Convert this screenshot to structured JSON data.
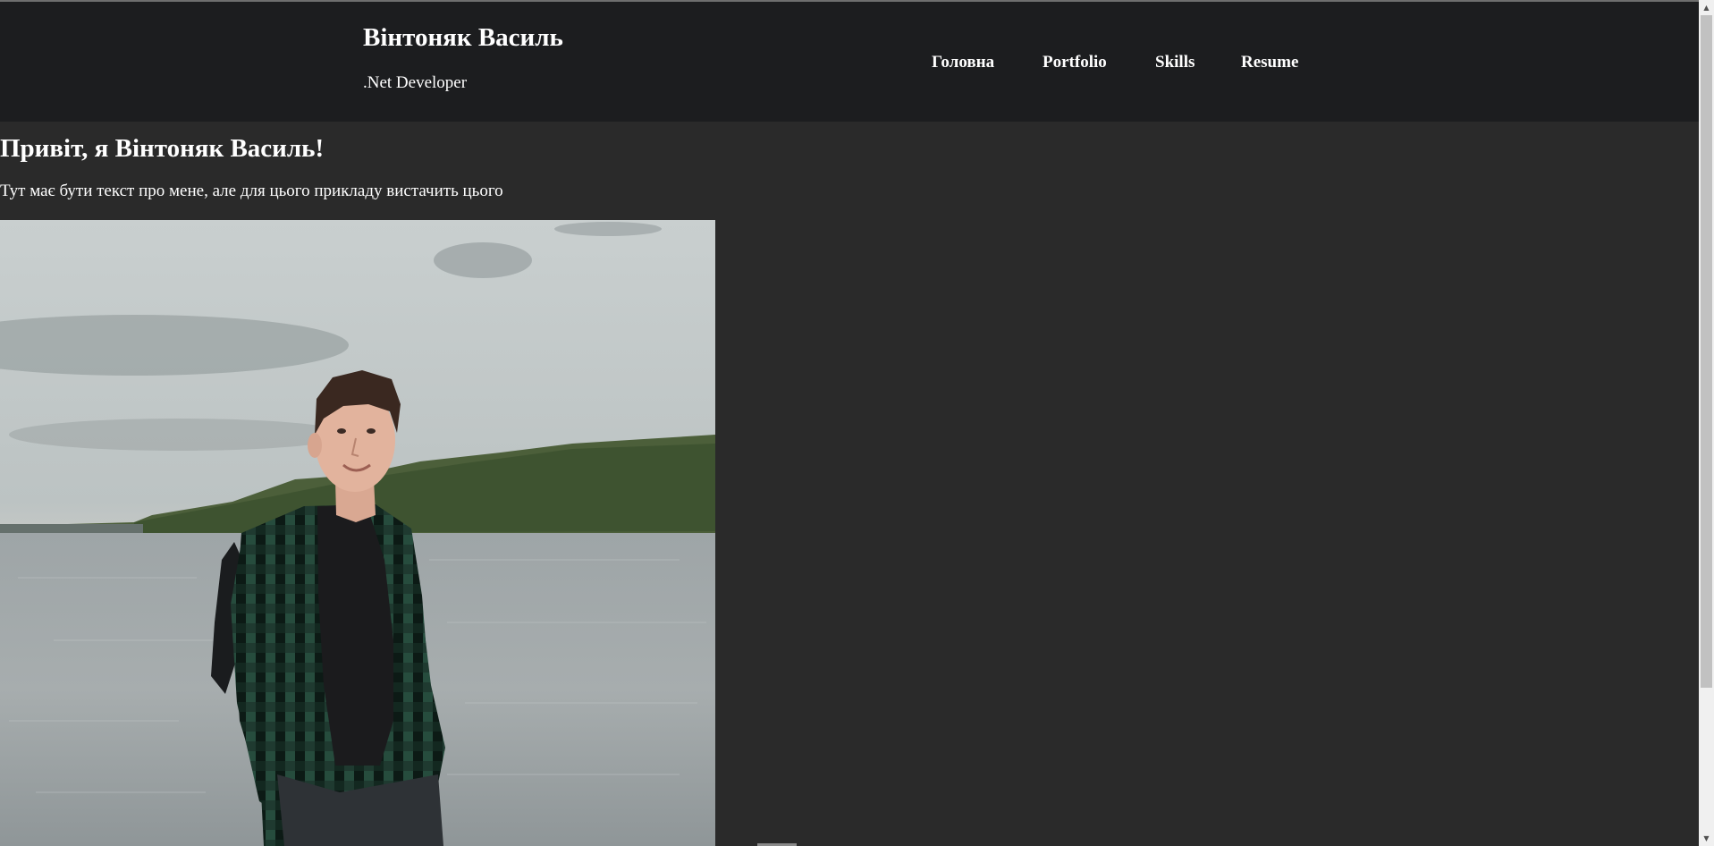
{
  "header": {
    "name": "Вінтоняк Василь",
    "role": ".Net Developer"
  },
  "nav": {
    "items": [
      {
        "label": "Головна"
      },
      {
        "label": "Portfolio"
      },
      {
        "label": "Skills"
      },
      {
        "label": "Resume"
      }
    ]
  },
  "main": {
    "greeting": "Привіт, я Вінтоняк Василь!",
    "about": "Тут має бути текст про мене, але для цього прикладу вистачить цього"
  },
  "scrollbar": {
    "up_icon": "triangle-up",
    "down_icon": "triangle-down"
  },
  "colors": {
    "header_bg": "#1c1d1f",
    "page_bg": "#2a2a2a",
    "text": "#ffffff"
  }
}
